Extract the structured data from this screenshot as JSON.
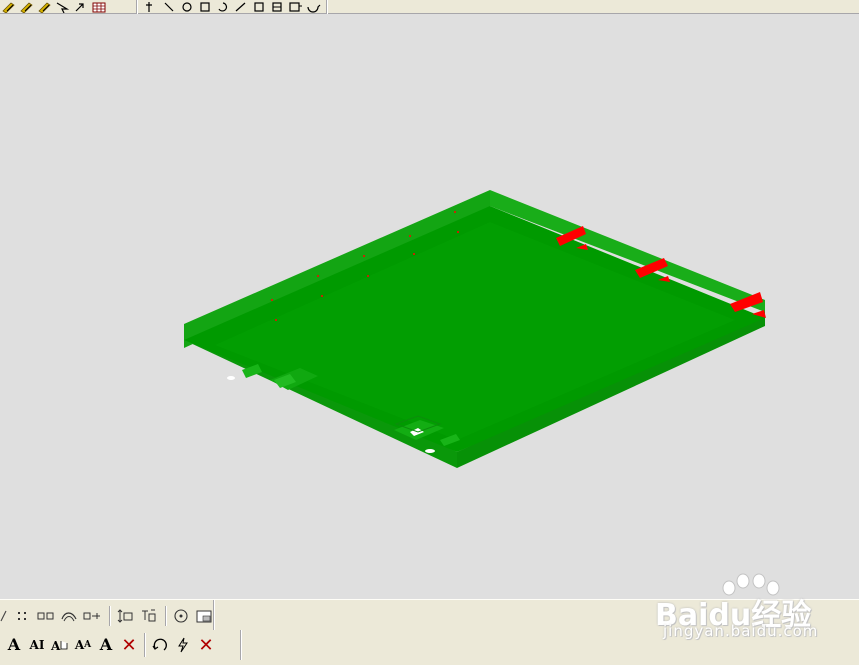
{
  "colors": {
    "viewport_bg": "#dfdfdf",
    "toolbar_bg": "#ece9d8",
    "model_top": "#009900",
    "model_side_front": "#0f9b0f",
    "model_side_left": "#12a312",
    "highlight": "#ff0000"
  },
  "top_toolbar": {
    "group1_icons": [
      "pencil-icon",
      "pencil-icon",
      "pencil-icon",
      "arrow-icon",
      "arrow-icon",
      "grid-icon"
    ],
    "group2_icons": [
      "cursor-icon",
      "arrow-icon",
      "circle-icon",
      "box-icon",
      "rotate-icon",
      "line-icon",
      "box-icon",
      "box-icon",
      "box-icon",
      "refresh-icon"
    ]
  },
  "bottom_toolbar": {
    "row1_icons": [
      "line-icon",
      "points-icon",
      "rectangles-icon",
      "curve-icon",
      "align-icon",
      "measure-icon",
      "dimension-icon",
      "target-icon",
      "window-icon"
    ],
    "row2": {
      "text_buttons": [
        {
          "label": "A",
          "size": "big"
        },
        {
          "label": "AI",
          "size": "small"
        },
        {
          "label": "A",
          "size": "small"
        },
        {
          "label": "A",
          "size": "small"
        },
        {
          "label": "A",
          "size": "big"
        }
      ],
      "delete_label": "✕",
      "right_icons": [
        "rotate-icon",
        "lightning-icon"
      ],
      "close_label": "✕"
    }
  },
  "watermark": {
    "brand": "Baidu经验",
    "url": "jingyan.baidu.com"
  }
}
